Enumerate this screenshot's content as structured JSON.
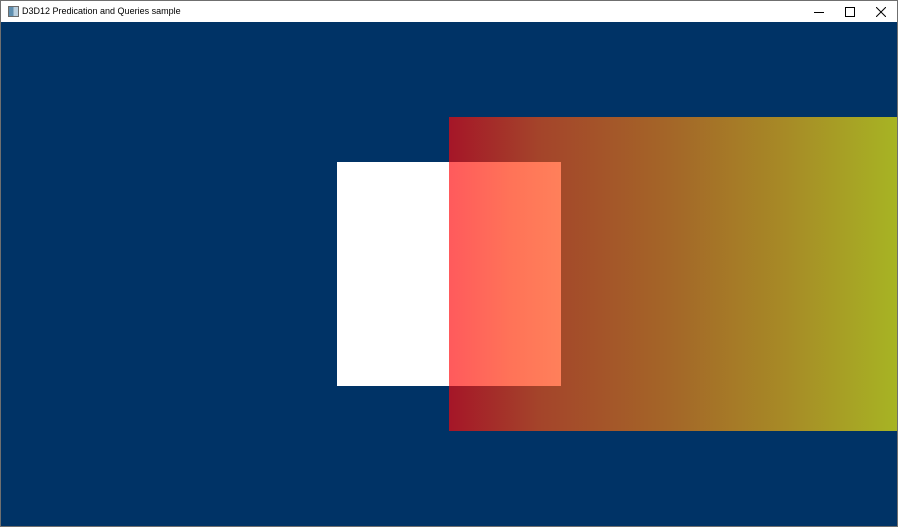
{
  "window": {
    "title": "D3D12 Predication and Queries sample",
    "icon": "app-window-icon",
    "controls": [
      {
        "name": "minimize-button",
        "icon": "minimize-icon"
      },
      {
        "name": "maximize-button",
        "icon": "maximize-icon"
      },
      {
        "name": "close-button",
        "icon": "close-icon"
      }
    ]
  },
  "scene": {
    "clear_color": "#003366",
    "occluder_color": "#ffffff",
    "gradient_colors": [
      "#a51628",
      "#a7b424"
    ],
    "overlap_colors": [
      "#ff5a5c",
      "#ff805a"
    ]
  }
}
